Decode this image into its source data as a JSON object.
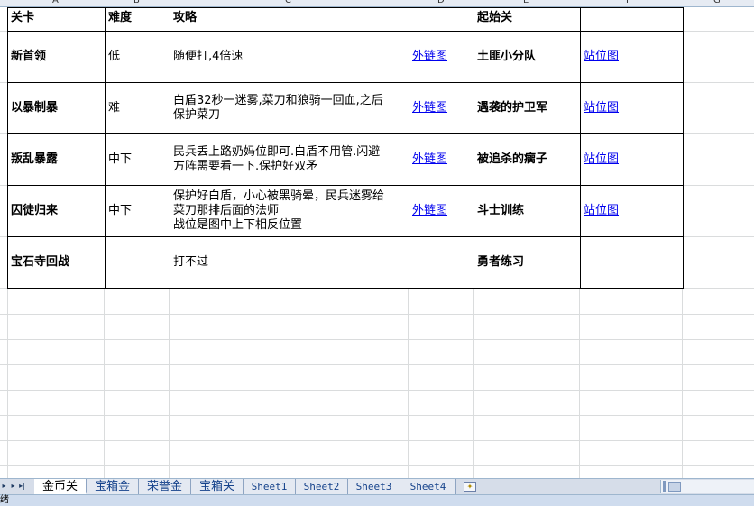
{
  "columns": {
    "A": "A",
    "B": "B",
    "C": "C",
    "D": "D",
    "E": "E",
    "F": "F",
    "G": "G"
  },
  "header": {
    "level": "关卡",
    "difficulty": "难度",
    "strategy": "攻略",
    "link": "",
    "start_level": "起始关",
    "position": ""
  },
  "rows": [
    {
      "level": "新首领",
      "difficulty": "低",
      "strategy": "随便打,4倍速",
      "link": "外链图",
      "start_level": "土匪小分队",
      "position": "站位图"
    },
    {
      "level": "以暴制暴",
      "difficulty": "难",
      "strategy": "白盾32秒一迷雾,菜刀和狼骑一回血,之后\n保护菜刀",
      "link": "外链图",
      "start_level": "遇袭的护卫军",
      "position": "站位图"
    },
    {
      "level": "叛乱暴露",
      "difficulty": "中下",
      "strategy": "民兵丢上路奶妈位即可.白盾不用管.闪避\n方阵需要看一下.保护好双矛",
      "link": "外链图",
      "start_level": "被追杀的瘸子",
      "position": "站位图"
    },
    {
      "level": "囚徒归来",
      "difficulty": "中下",
      "strategy": "保护好白盾，小心被黑骑晕，民兵迷雾给\n菜刀那排后面的法师\n战位是图中上下相反位置",
      "link": "外链图",
      "start_level": "斗士训练",
      "position": "站位图"
    },
    {
      "level": "宝石寺回战",
      "difficulty": "",
      "strategy": "打不过",
      "link": "",
      "start_level": "勇者练习",
      "position": ""
    }
  ],
  "tabs": [
    "金币关",
    "宝箱金",
    "荣誉金",
    "宝箱关",
    "Sheet1",
    "Sheet2",
    "Sheet3",
    "Sheet4"
  ],
  "status": {
    "text": "绪"
  },
  "colors": {
    "link": "#0000ee",
    "tabbar": "#d6dde9",
    "statusbar": "#cfdcee",
    "gridline": "#dadcdd"
  },
  "icons": {
    "nav_first": "first-sheet-icon",
    "nav_prev": "prev-sheet-icon",
    "nav_next": "next-sheet-icon",
    "nav_last": "last-sheet-icon",
    "new_sheet": "insert-sheet-icon"
  }
}
